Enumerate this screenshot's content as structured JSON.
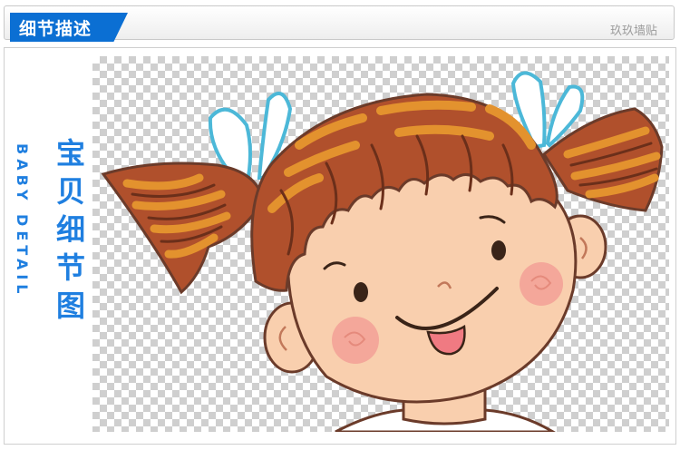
{
  "header": {
    "title": "细节描述",
    "brand": "玖玖墙贴",
    "accent_color": "#0b6fd3"
  },
  "side": {
    "title_chars": [
      "宝",
      "贝",
      "细",
      "节",
      "图"
    ],
    "subtitle": "BABY DETAIL",
    "color": "#1f7fe0"
  },
  "image": {
    "icon": "cartoon-girl-illustration",
    "background": "transparent-checkerboard"
  }
}
